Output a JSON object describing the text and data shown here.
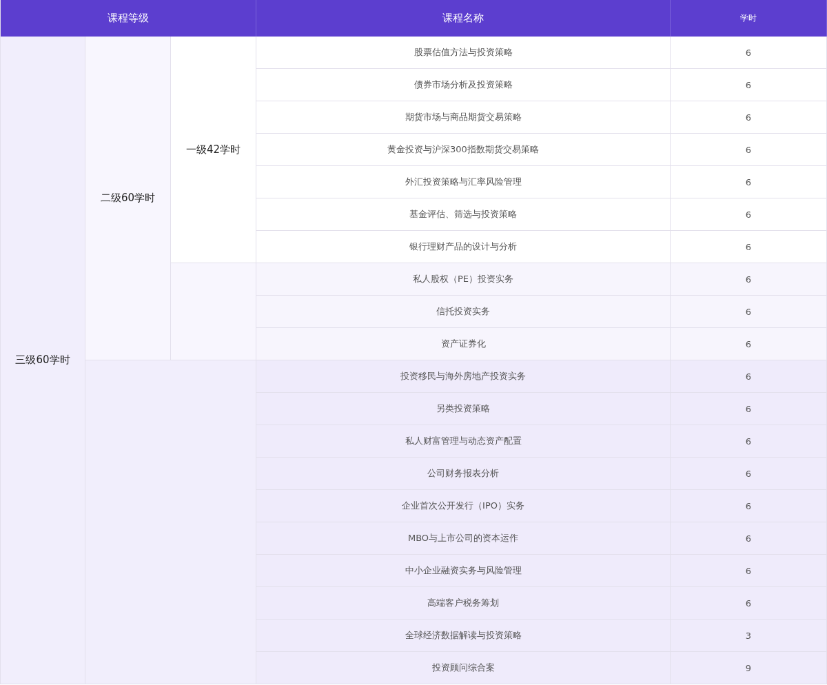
{
  "header": {
    "level": "课程等级",
    "course": "课程名称",
    "hours": "学时"
  },
  "levels": [
    {
      "label": "三级60学时",
      "children": [
        {
          "label": "二级60学时",
          "children": [
            {
              "label": "一级42学时",
              "courses": [
                {
                  "name": "股票估值方法与投资策略",
                  "hours": "6"
                },
                {
                  "name": "债券市场分析及投资策略",
                  "hours": "6"
                },
                {
                  "name": "期货市场与商品期货交易策略",
                  "hours": "6"
                },
                {
                  "name": "黄金投资与沪深300指数期货交易策略",
                  "hours": "6"
                },
                {
                  "name": "外汇投资策略与汇率风险管理",
                  "hours": "6"
                },
                {
                  "name": "基金评估、筛选与投资策略",
                  "hours": "6"
                },
                {
                  "name": "银行理财产品的设计与分析",
                  "hours": "6"
                }
              ]
            }
          ],
          "courses": [
            {
              "name": "私人股权（PE）投资实务",
              "hours": "6"
            },
            {
              "name": "信托投资实务",
              "hours": "6"
            },
            {
              "name": "资产证券化",
              "hours": "6"
            }
          ]
        }
      ],
      "courses": [
        {
          "name": "投资移民与海外房地产投资实务",
          "hours": "6"
        },
        {
          "name": "另类投资策略",
          "hours": "6"
        },
        {
          "name": "私人财富管理与动态资产配置",
          "hours": "6"
        },
        {
          "name": "公司财务报表分析",
          "hours": "6"
        },
        {
          "name": "企业首次公开发行（IPO）实务",
          "hours": "6"
        },
        {
          "name": "MBO与上市公司的资本运作",
          "hours": "6"
        },
        {
          "name": "中小企业融资实务与风险管理",
          "hours": "6"
        },
        {
          "name": "高端客户税务筹划",
          "hours": "6"
        },
        {
          "name": "全球经济数据解读与投资策略",
          "hours": "3"
        },
        {
          "name": "投资顾问综合案",
          "hours": "9"
        }
      ]
    }
  ]
}
